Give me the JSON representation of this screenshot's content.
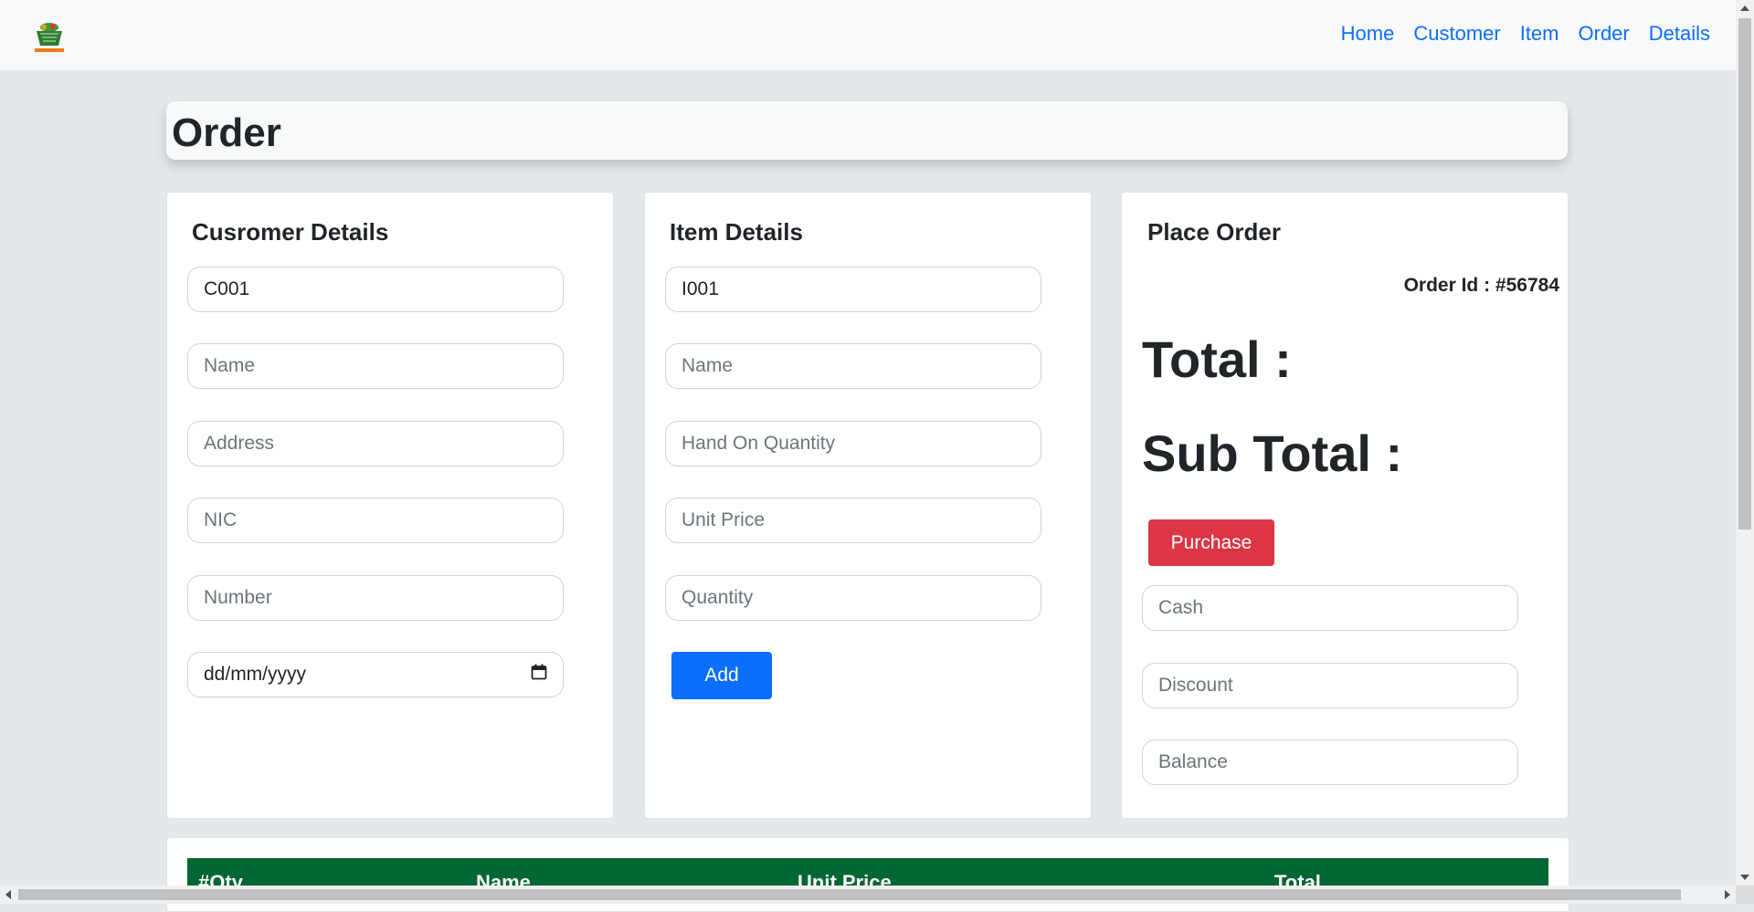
{
  "navbar": {
    "logo_icon": "supermarket-basket-logo",
    "links": [
      "Home",
      "Customer",
      "Item",
      "Order",
      "Details"
    ]
  },
  "header": {
    "title": "Order"
  },
  "customer_panel": {
    "title": "Cusromer Details",
    "id_value": "C001",
    "name_placeholder": "Name",
    "address_placeholder": "Address",
    "nic_placeholder": "NIC",
    "number_placeholder": "Number",
    "date_placeholder": "dd/mm/yyyy"
  },
  "item_panel": {
    "title": "Item Details",
    "id_value": "I001",
    "name_placeholder": "Name",
    "qoh_placeholder": "Hand On Quantity",
    "unit_price_placeholder": "Unit Price",
    "quantity_placeholder": "Quantity",
    "add_label": "Add"
  },
  "order_panel": {
    "title": "Place Order",
    "order_id": "Order Id : #56784",
    "total_label": "Total :",
    "subtotal_label": "Sub Total :",
    "purchase_label": "Purchase",
    "cash_placeholder": "Cash",
    "discount_placeholder": "Discount",
    "balance_placeholder": "Balance"
  },
  "table": {
    "headers": [
      "#Qty",
      "Name",
      "Unit Price",
      "Total"
    ]
  },
  "colors": {
    "primary": "#0d6efd",
    "danger": "#dc3545",
    "table_header": "#006633",
    "background": "#e5e8eb"
  }
}
